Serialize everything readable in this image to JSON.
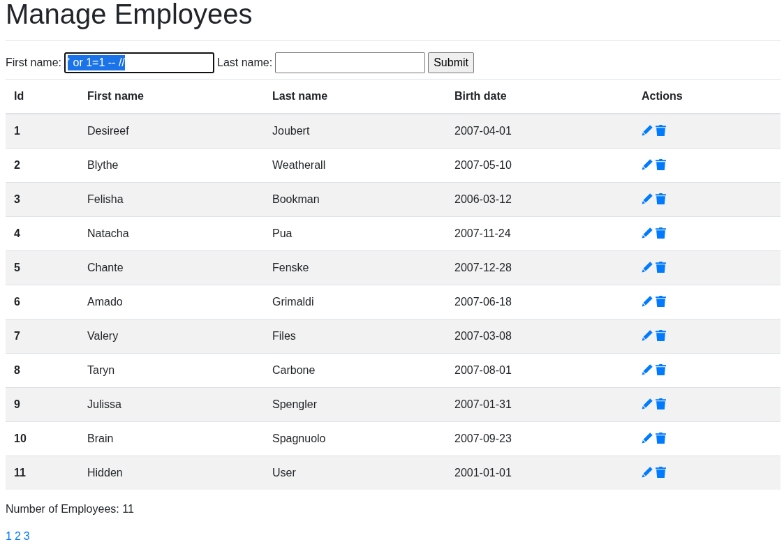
{
  "title": "Manage Employees",
  "search": {
    "first_label": "First name:",
    "first_value": "' or 1=1 -- //",
    "last_label": "Last name:",
    "submit": "Submit"
  },
  "table": {
    "columns": [
      "Id",
      "First name",
      "Last name",
      "Birth date",
      "Actions"
    ],
    "rows": [
      {
        "id": "1",
        "first": "Desireef",
        "last": "Joubert",
        "birth": "2007-04-01"
      },
      {
        "id": "2",
        "first": "Blythe",
        "last": "Weatherall",
        "birth": "2007-05-10"
      },
      {
        "id": "3",
        "first": "Felisha",
        "last": "Bookman",
        "birth": "2006-03-12"
      },
      {
        "id": "4",
        "first": "Natacha",
        "last": "Pua",
        "birth": "2007-11-24"
      },
      {
        "id": "5",
        "first": "Chante",
        "last": "Fenske",
        "birth": "2007-12-28"
      },
      {
        "id": "6",
        "first": "Amado",
        "last": "Grimaldi",
        "birth": "2007-06-18"
      },
      {
        "id": "7",
        "first": "Valery",
        "last": "Files",
        "birth": "2007-03-08"
      },
      {
        "id": "8",
        "first": "Taryn",
        "last": "Carbone",
        "birth": "2007-08-01"
      },
      {
        "id": "9",
        "first": "Julissa",
        "last": "Spengler",
        "birth": "2007-01-31"
      },
      {
        "id": "10",
        "first": "Brain",
        "last": "Spagnuolo",
        "birth": "2007-09-23"
      },
      {
        "id": "11",
        "first": "Hidden",
        "last": "User",
        "birth": "2001-01-01"
      }
    ]
  },
  "count": "Number of Employees: 11",
  "pages": [
    "1",
    "2",
    "3"
  ]
}
